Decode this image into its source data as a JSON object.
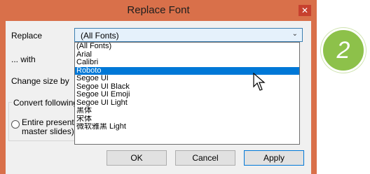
{
  "window": {
    "title": "Replace Font",
    "close_glyph": "✕"
  },
  "form": {
    "replace_label": "Replace",
    "with_label": "... with",
    "change_size_label": "Change size by",
    "convert_label": "Convert following s",
    "entire_line1": "Entire presenta",
    "entire_line2": "master slides)"
  },
  "combo": {
    "value": "(All Fonts)",
    "arrow_glyph": "⌄"
  },
  "font_list": [
    {
      "label": "(All Fonts)",
      "selected": false
    },
    {
      "label": "Arial",
      "selected": false
    },
    {
      "label": "Calibri",
      "selected": false
    },
    {
      "label": "Roboto",
      "selected": true
    },
    {
      "label": "Segoe UI",
      "selected": false
    },
    {
      "label": "Segoe UI Black",
      "selected": false
    },
    {
      "label": "Segoe UI Emoji",
      "selected": false
    },
    {
      "label": "Segoe UI Light",
      "selected": false
    },
    {
      "label": "黑体",
      "selected": false
    },
    {
      "label": "宋体",
      "selected": false
    },
    {
      "label": "微软雅黑 Light",
      "selected": false
    }
  ],
  "buttons": {
    "ok": "OK",
    "cancel": "Cancel",
    "apply": "Apply"
  },
  "step_badge": "2",
  "colors": {
    "title_bar": "#d9704a",
    "selection": "#0078d7",
    "badge": "#8dc14a"
  },
  "icons": {
    "pointer": "mouse-pointer-icon"
  }
}
